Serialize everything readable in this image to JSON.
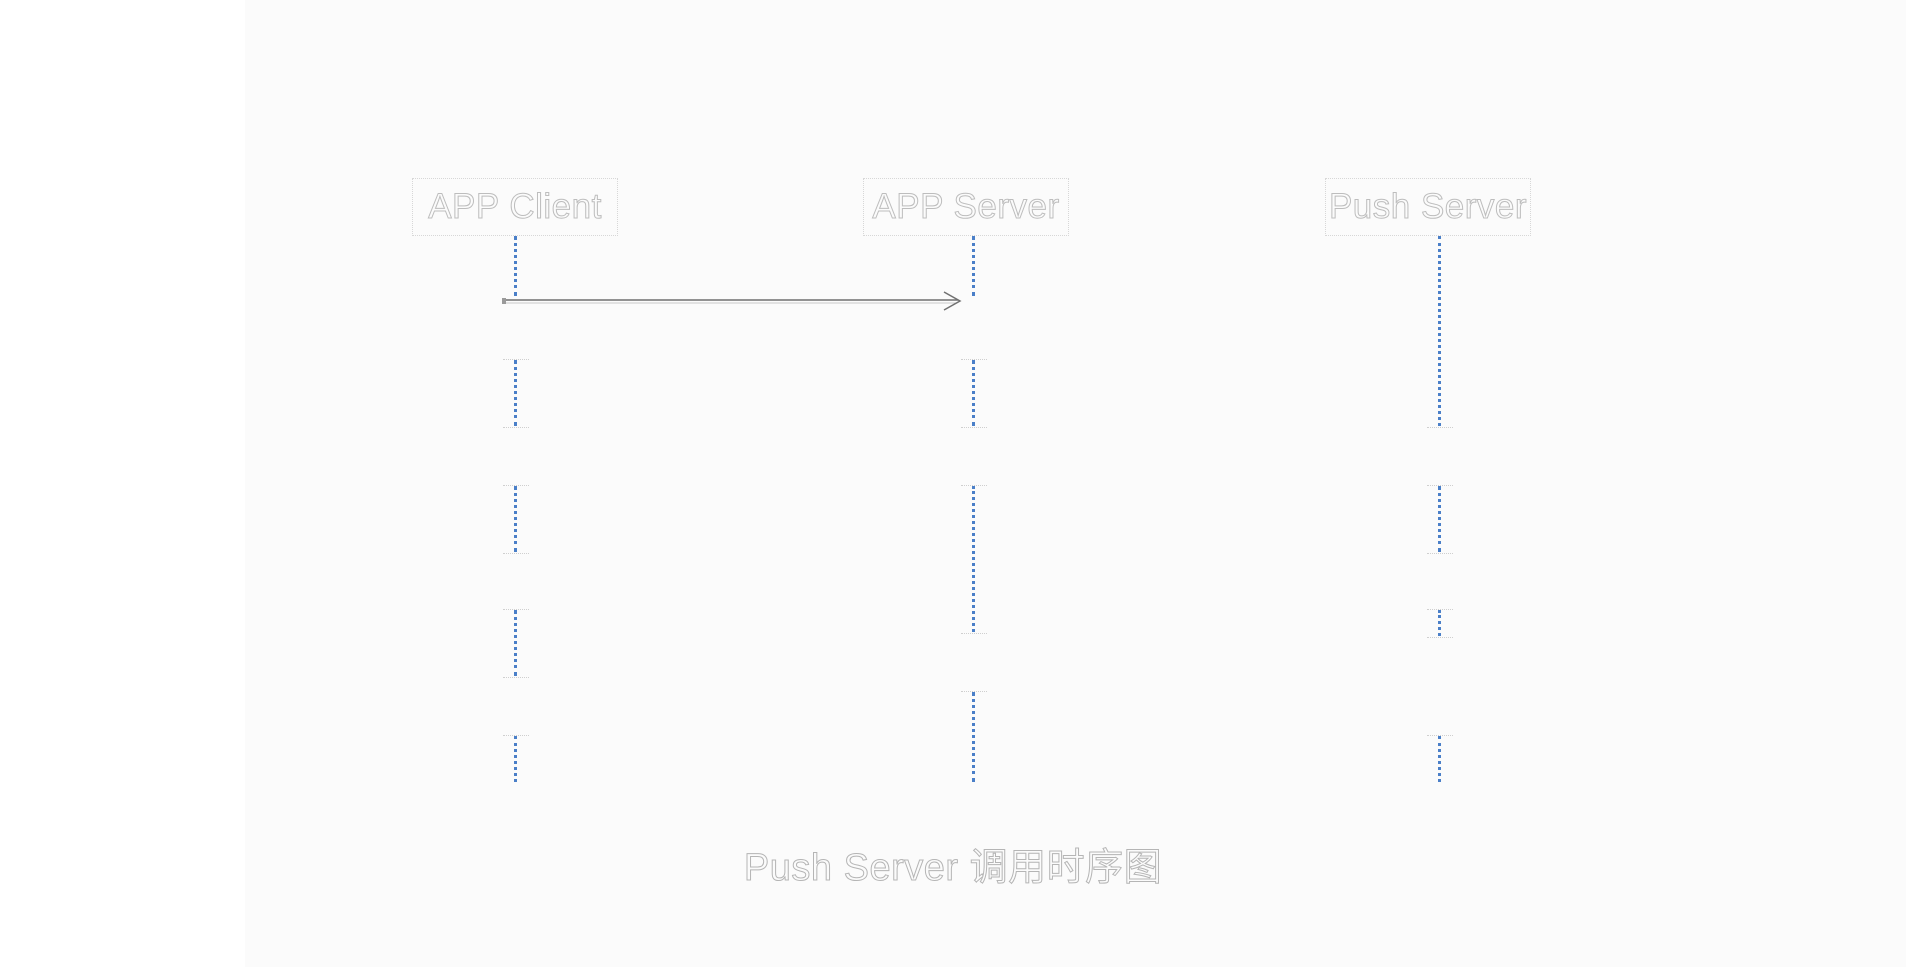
{
  "actors": [
    {
      "id": "app-client",
      "label": "APP Client"
    },
    {
      "id": "app-server",
      "label": "APP Server"
    },
    {
      "id": "push-server",
      "label": "Push Server"
    }
  ],
  "messages": [
    {
      "from": "app-client",
      "to": "app-server",
      "label": ""
    }
  ],
  "caption": "Push Server 调用时序图",
  "colors": {
    "lifeline": "#4a7fc8",
    "arrow": "#707070",
    "background": "#fbfbfb",
    "label_outline": "#bdbdbd"
  }
}
